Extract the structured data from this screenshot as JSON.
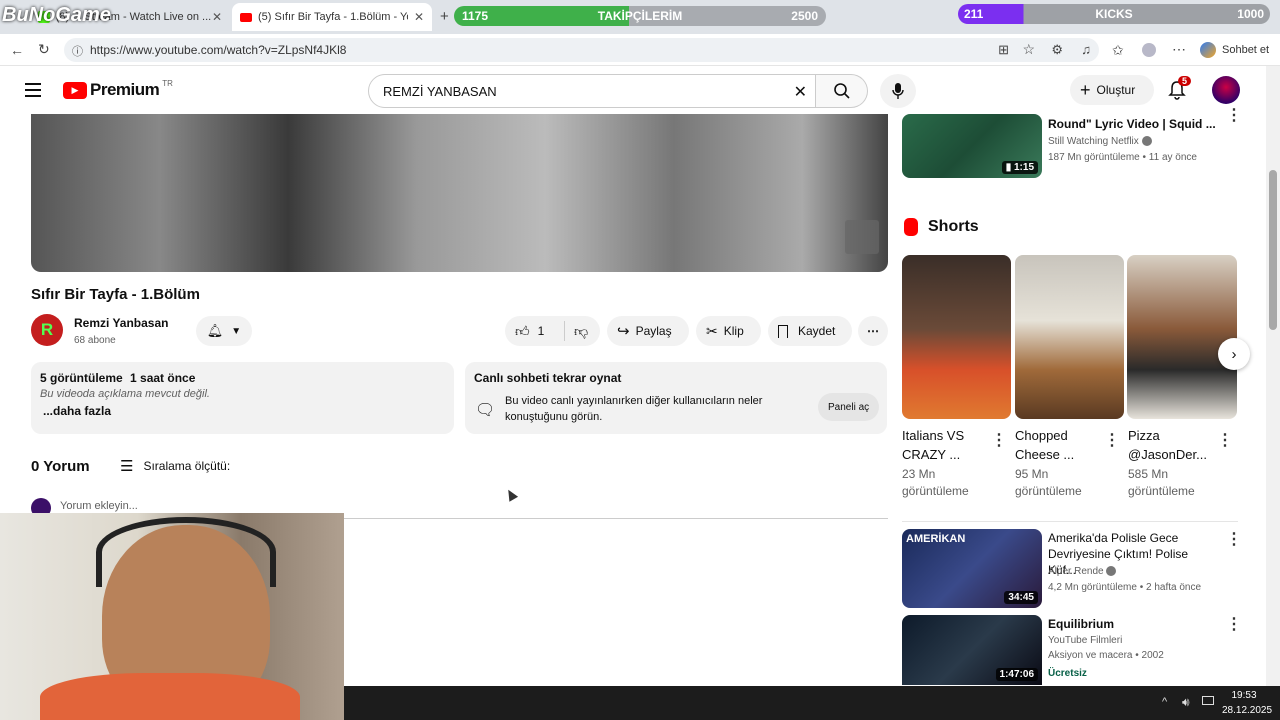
{
  "browser": {
    "tabs": [
      {
        "label": "(8) ... Stream - Watch Live on ..."
      },
      {
        "label": "(5) Sıfır Bir Tayfa - 1.Bölüm - YouTu..."
      }
    ],
    "url": "https://www.youtube.com/watch?v=ZLpsNf4JKl8",
    "copilot_label": "Sohbet et"
  },
  "stream_overlay": {
    "logo": "BuNoGame",
    "followers_current": "1175",
    "followers_label": "TAKİPÇİLERİM",
    "followers_goal": "2500",
    "kicks_current": "211",
    "kicks_label": "KICKS",
    "kicks_goal": "1000"
  },
  "youtube": {
    "logo_text": "Premium",
    "logo_region": "TR",
    "search_value": "REMZİ YANBASAN",
    "create_label": "Oluştur",
    "notif_count": "5"
  },
  "video": {
    "title": "Sıfır Bir Tayfa - 1.Bölüm",
    "channel": "Remzi Yanbasan",
    "channel_initial": "R",
    "subscribers": "68 abone",
    "likes": "1",
    "share": "Paylaş",
    "clip": "Klip",
    "save": "Kaydet",
    "views": "5 görüntüleme",
    "age": "1 saat önce",
    "description": "Bu videoda açıklama mevcut değil.",
    "more": "...daha fazla"
  },
  "chat_replay": {
    "title": "Canlı sohbeti tekrar oynat",
    "text": "Bu video canlı yayınlanırken diğer kullanıcıların neler konuştuğunu görün.",
    "button": "Paneli aç"
  },
  "comments": {
    "count_label": "0 Yorum",
    "sort_label": "Sıralama ölçütü:",
    "placeholder": "Yorum ekleyin..."
  },
  "sidebar": {
    "top_video": {
      "title": "Round\" Lyric Video | Squid ...",
      "channel": "Still Watching Netflix",
      "meta": "187 Mn görüntüleme • 11 ay önce",
      "duration": "1:15"
    },
    "shorts_label": "Shorts",
    "shorts": [
      {
        "title": "Italians VS CRAZY ...",
        "views": "23 Mn görüntüleme"
      },
      {
        "title": "Chopped Cheese ...",
        "views": "95 Mn görüntüleme"
      },
      {
        "title": "Pizza @JasonDer...",
        "views": "585 Mn görüntüleme"
      }
    ],
    "videos": [
      {
        "title": "Amerika'da Polisle Gece Devriyesine Çıktım! Polise Küf...",
        "channel": "Alper Rende",
        "meta": "4,2 Mn görüntüleme • 2 hafta önce",
        "duration": "34:45",
        "thumb_text": "AMERİKAN"
      },
      {
        "title": "Equilibrium",
        "channel": "YouTube Filmleri",
        "meta": "Aksiyon ve macera • 2002",
        "badge": "Ücretsiz",
        "duration": "1:47:06"
      }
    ]
  },
  "taskbar": {
    "time": "19:53",
    "date": "28.12.2025"
  }
}
